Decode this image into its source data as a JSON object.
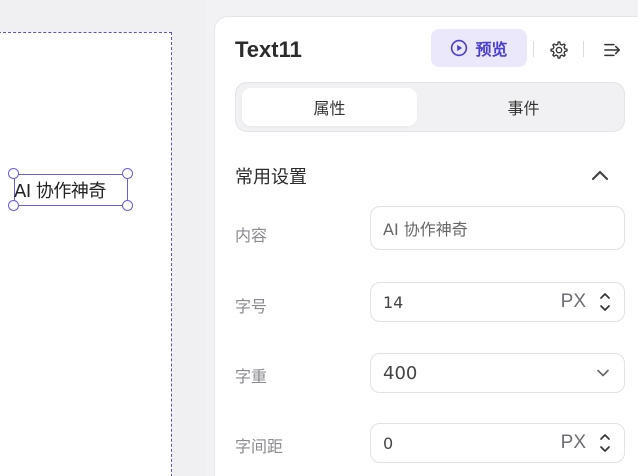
{
  "canvas": {
    "selected_text": "AI 协作神奇"
  },
  "panel": {
    "title": "Text11",
    "preview_label": "预览",
    "tabs": [
      {
        "label": "属性",
        "active": true
      },
      {
        "label": "事件",
        "active": false
      }
    ],
    "section": {
      "title": "常用设置",
      "expanded": true
    },
    "fields": {
      "content": {
        "label": "内容",
        "value": "AI 协作神奇"
      },
      "font_size": {
        "label": "字号",
        "value": "14",
        "unit": "PX"
      },
      "font_weight": {
        "label": "字重",
        "value": "400"
      },
      "letter_spacing": {
        "label": "字间距",
        "value": "0",
        "unit": "PX"
      }
    }
  },
  "icons": {
    "preview": "play-circle-icon",
    "settings": "gear-icon",
    "collapse": "collapse-panel-icon",
    "section_toggle": "chevron-up-icon",
    "stepper": "stepper-arrows-icon",
    "dropdown": "chevron-down-icon"
  },
  "colors": {
    "accent": "#4b3fcf",
    "accent_bg": "#ebe8fc",
    "selection": "#6a5ce0"
  }
}
